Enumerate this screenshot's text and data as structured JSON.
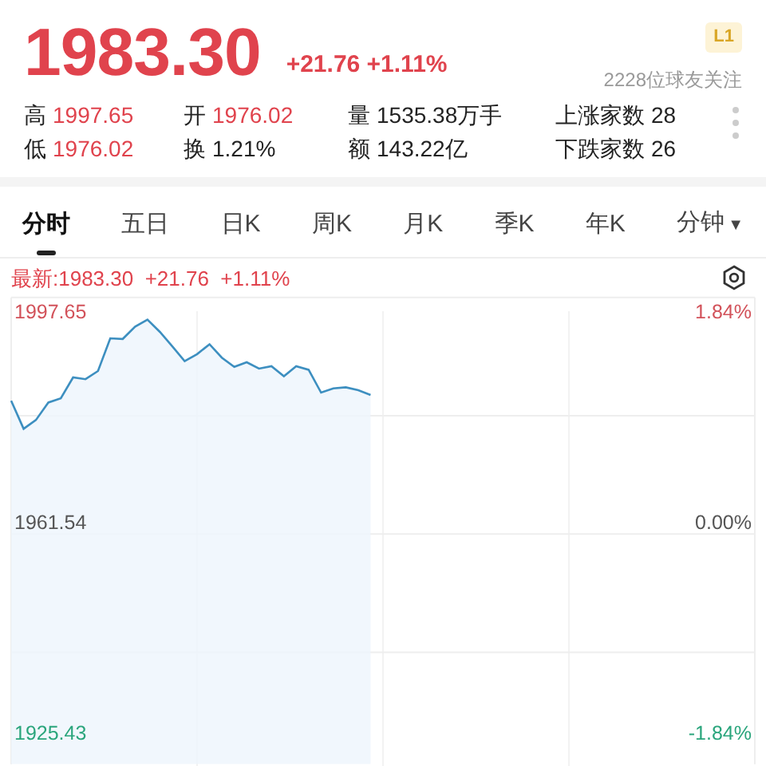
{
  "quote": {
    "price": "1983.30",
    "change": "+21.76 +1.11%",
    "level_badge": "L1",
    "followers": "2228位球友关注"
  },
  "stats": [
    {
      "label": "高",
      "value": "1997.65",
      "color": "#e0434d"
    },
    {
      "label": "开",
      "value": "1976.02",
      "color": "#e0434d"
    },
    {
      "label": "量",
      "value": "1535.38万手",
      "color": "#222222"
    },
    {
      "label": "上涨家数",
      "value": "28",
      "color": "#222222"
    },
    {
      "label": "低",
      "value": "1976.02",
      "color": "#e0434d"
    },
    {
      "label": "换",
      "value": "1.21%",
      "color": "#222222"
    },
    {
      "label": "额",
      "value": "143.22亿",
      "color": "#222222"
    },
    {
      "label": "下跌家数",
      "value": "26",
      "color": "#222222"
    }
  ],
  "tabs": [
    {
      "label": "分时",
      "selected": true
    },
    {
      "label": "五日",
      "selected": false
    },
    {
      "label": "日K",
      "selected": false
    },
    {
      "label": "周K",
      "selected": false
    },
    {
      "label": "月K",
      "selected": false
    },
    {
      "label": "季K",
      "selected": false
    },
    {
      "label": "年K",
      "selected": false
    },
    {
      "label": "分钟",
      "selected": false,
      "caret": "▼"
    }
  ],
  "chart": {
    "latest": "最新:1983.30  +21.76  +1.11%",
    "right_ticks": [
      {
        "label": "1.84%",
        "color": "#d2525a"
      },
      {
        "label": "0.00%",
        "color": "#555555"
      },
      {
        "label": "-1.84%",
        "color": "#2aa57c"
      }
    ],
    "chart_data": {
      "type": "area",
      "ylim": [
        1920,
        2000
      ],
      "yticks": [
        {
          "value": 1997.65,
          "label": "1997.65"
        },
        {
          "value": 1961.54,
          "label": "1961.54"
        },
        {
          "value": 1925.43,
          "label": "1925.43"
        }
      ],
      "categories": [
        null,
        null,
        null,
        null,
        null,
        null,
        null,
        null,
        null,
        null,
        null,
        null,
        null,
        null,
        null,
        null,
        null,
        null,
        null,
        null,
        null,
        null,
        null,
        null,
        null,
        null,
        null,
        null,
        null,
        null,
        null,
        null,
        null,
        null,
        null,
        null,
        null,
        null,
        null,
        null,
        null,
        null,
        null,
        null,
        null,
        null,
        null,
        null,
        null,
        null,
        null,
        null,
        null,
        null,
        null,
        null,
        null,
        null,
        null,
        null,
        null
      ],
      "series": [
        {
          "color": "#3d8fc0",
          "values": [
            1982.3,
            1977.5,
            1979.0,
            1982.0,
            1982.7,
            1986.3,
            1986.0,
            1987.4,
            1993.0,
            1992.9,
            1995.0,
            1996.2,
            1994.1,
            1991.6,
            1989.1,
            1990.3,
            1992.0,
            1989.7,
            1988.1,
            1988.9,
            1987.8,
            1988.2,
            1986.5,
            1988.2,
            1987.6,
            1983.7,
            1984.4,
            1984.6,
            1984.1,
            1983.3,
            null,
            null,
            null,
            null,
            null,
            null,
            null,
            null,
            null,
            null,
            null,
            null,
            null,
            null,
            null,
            null,
            null,
            null,
            null,
            null,
            null,
            null,
            null,
            null,
            null,
            null,
            null,
            null,
            null,
            null,
            null
          ]
        }
      ]
    }
  }
}
